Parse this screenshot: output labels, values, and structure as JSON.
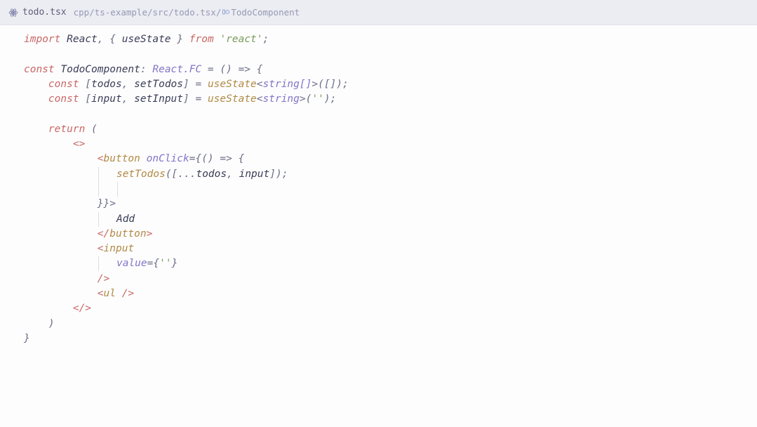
{
  "breadcrumb": {
    "filename": "todo.tsx",
    "path": "cpp/ts-example/src/todo.tsx/",
    "symbol": "TodoComponent"
  },
  "code": {
    "l1": {
      "kw1": "import",
      "def1": "React",
      "punc1": ", { ",
      "def2": "useState",
      "punc2": " } ",
      "kw2": "from",
      "sp": " ",
      "str": "'react'",
      "end": ";"
    },
    "l3": {
      "kw": "const",
      "def": "TodoComponent",
      "punc1": ": ",
      "type": "React.FC",
      "punc2": " = () => {"
    },
    "l4": {
      "indent": "    ",
      "kw": "const",
      "sp": " ",
      "punc1": "[",
      "def1": "todos",
      "punc2": ", ",
      "def2": "setTodos",
      "punc3": "] = ",
      "fn": "useState",
      "punc4": "<",
      "type": "string[]",
      "punc5": ">([]);"
    },
    "l5": {
      "indent": "    ",
      "kw": "const",
      "sp": " ",
      "punc1": "[",
      "def1": "input",
      "punc2": ", ",
      "def2": "setInput",
      "punc3": "] = ",
      "fn": "useState",
      "punc4": "<",
      "type": "string",
      "punc5": ">(",
      "str": "''",
      "punc6": ");"
    },
    "l7": {
      "indent": "    ",
      "kw": "return",
      "punc": " ("
    },
    "l8": {
      "indent": "        ",
      "frag": "<>"
    },
    "l9": {
      "indent": "            ",
      "b1": "<",
      "tag": "button",
      "sp": " ",
      "attr": "onClick",
      "eq": "=",
      "brace": "{",
      "arrow": "() => {"
    },
    "l10": {
      "indent": "                ",
      "fn": "setTodos",
      "punc1": "([...",
      "def1": "todos",
      "punc2": ", ",
      "def2": "input",
      "punc3": "]);"
    },
    "l11": {
      "indent": "                "
    },
    "l12": {
      "indent": "            ",
      "close": "}}>"
    },
    "l13": {
      "indent": "                ",
      "txt": "Add"
    },
    "l14": {
      "indent": "            ",
      "b1": "</",
      "tag": "button",
      "b2": ">"
    },
    "l15": {
      "indent": "            ",
      "b1": "<",
      "tag": "input"
    },
    "l16": {
      "indent": "                ",
      "attr": "value",
      "eq": "=",
      "brace1": "{",
      "str": "''",
      "brace2": "}"
    },
    "l17": {
      "indent": "            ",
      "close": "/>"
    },
    "l18": {
      "indent": "            ",
      "b1": "<",
      "tag": "ul",
      "b2": " />"
    },
    "l19": {
      "indent": "        ",
      "frag": "</>"
    },
    "l20": {
      "indent": "    ",
      "paren": ")"
    },
    "l21": {
      "brace": "}"
    }
  }
}
